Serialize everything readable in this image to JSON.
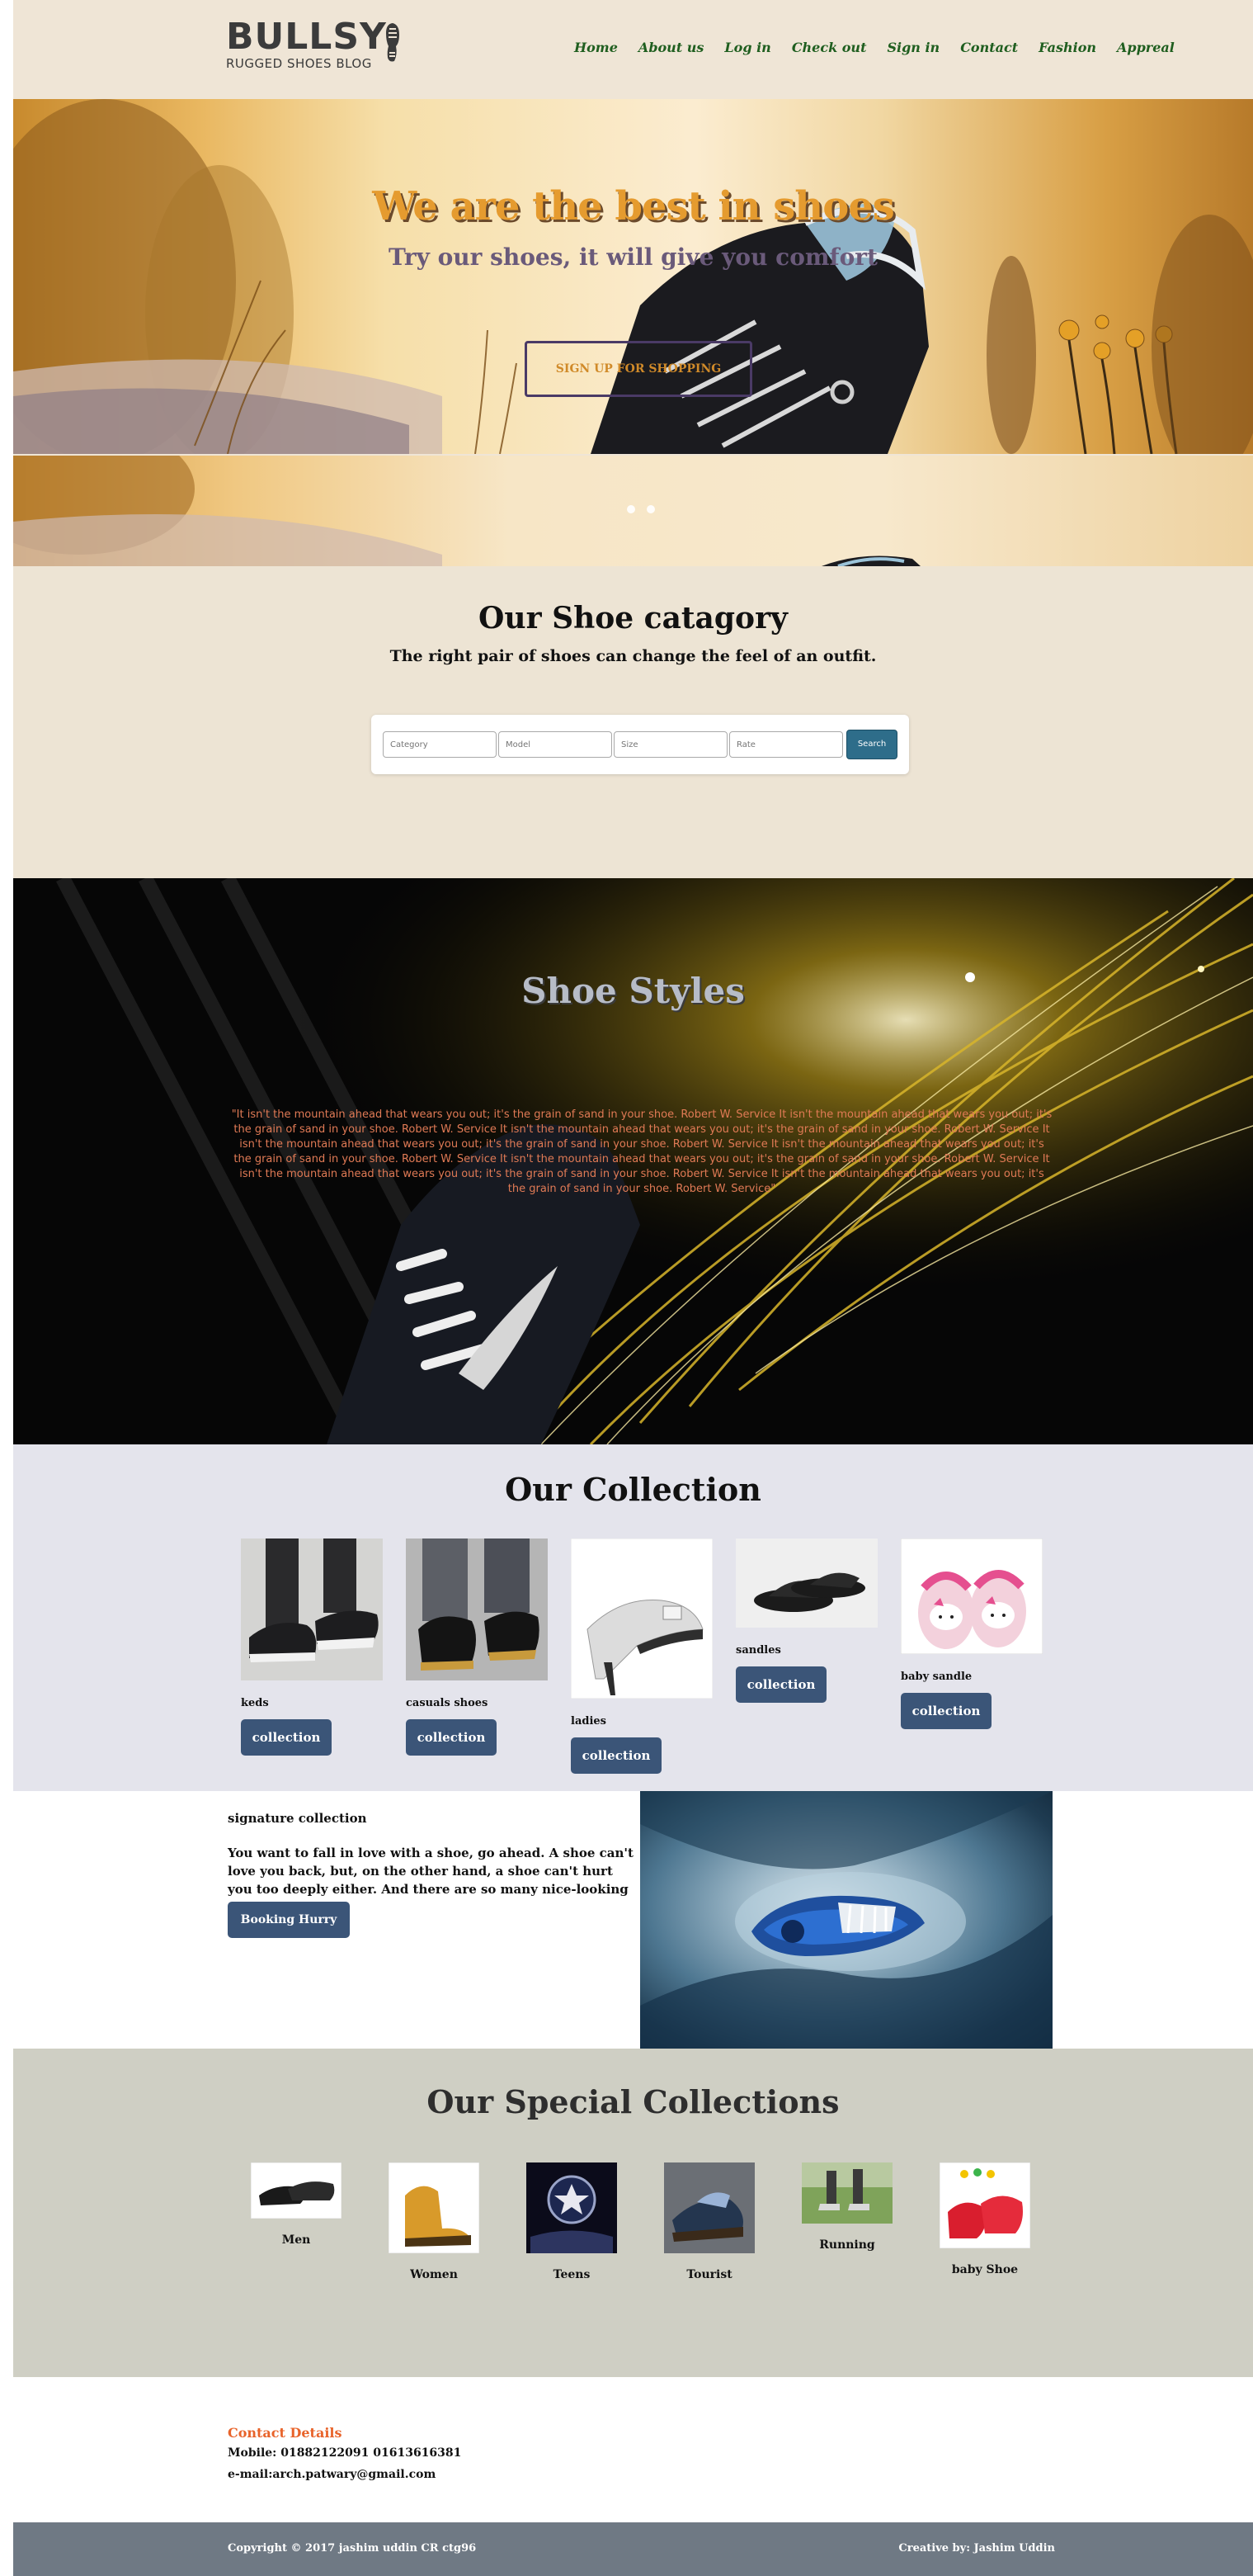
{
  "logo": {
    "main": "BULLSY",
    "sub": "RUGGED SHOES BLOG"
  },
  "nav": [
    "Home",
    "About us",
    "Log in",
    "Check out",
    "Sign in",
    "Contact",
    "Fashion",
    "Appreal"
  ],
  "hero": {
    "title": "We are the best in shoes",
    "subtitle": "Try our shoes, it will give you comfort",
    "button": "SIGN UP FOR SHOPPING"
  },
  "category": {
    "title": "Our Shoe catagory",
    "subtitle": "The right pair of shoes can change the feel of an outfit.",
    "fields": [
      {
        "placeholder": "Category"
      },
      {
        "placeholder": "Model"
      },
      {
        "placeholder": "Size"
      },
      {
        "placeholder": "Rate"
      }
    ],
    "search_button": "Search"
  },
  "styles": {
    "title": "Shoe Styles",
    "quote": "\"It isn't the mountain ahead that wears you out; it's the grain of sand in your shoe. Robert W. Service It isn't the mountain ahead that wears you out; it's the grain of sand in your shoe. Robert W. Service It isn't the mountain ahead that wears you out; it's the grain of sand in your shoe. Robert W. Service It isn't the mountain ahead that wears you out; it's the grain of sand in your shoe. Robert W. Service It isn't the mountain ahead that wears you out; it's the grain of sand in your shoe. Robert W. Service It isn't the mountain ahead that wears you out; it's the grain of sand in your shoe. Robert W. Service It isn't the mountain ahead that wears you out; it's the grain of sand in your shoe. Robert W. Service It isn't the mountain ahead that wears you out; it's the grain of sand in your shoe. Robert W. Service\""
  },
  "collection": {
    "title": "Our Collection",
    "items": [
      {
        "name": "keds",
        "button": "collection"
      },
      {
        "name": "casuals shoes",
        "button": "collection"
      },
      {
        "name": "ladies",
        "button": "collection"
      },
      {
        "name": "sandles",
        "button": "collection"
      },
      {
        "name": "baby sandle",
        "button": "collection"
      }
    ]
  },
  "signature": {
    "title": "signature collection",
    "text": "You want to fall in love with a shoe, go ahead. A shoe can't love you back, but, on the other hand, a shoe can't hurt you too deeply either. And there are so many nice-looking shoes.",
    "button": "Booking Hurry"
  },
  "special": {
    "title": "Our Special Collections",
    "items": [
      {
        "label": "Men"
      },
      {
        "label": "Women"
      },
      {
        "label": "Teens"
      },
      {
        "label": "Tourist"
      },
      {
        "label": "Running"
      },
      {
        "label": "baby Shoe"
      }
    ]
  },
  "contact": {
    "heading": "Contact Details",
    "mobile": "Mobile: 01882122091 01613616381",
    "email": "e-mail:arch.patwary@gmail.com"
  },
  "footer": {
    "copyright": "Copyright © 2017 jashim uddin CR ctg96",
    "credit": "Creative by: Jashim Uddin"
  },
  "colors": {
    "nav_link": "#1f5e1f",
    "hero_title": "#e59b2f",
    "button": "#3b5578",
    "search_button": "#2e6d8a",
    "contact_heading": "#e8632a",
    "footer_bg": "#6f7984"
  }
}
